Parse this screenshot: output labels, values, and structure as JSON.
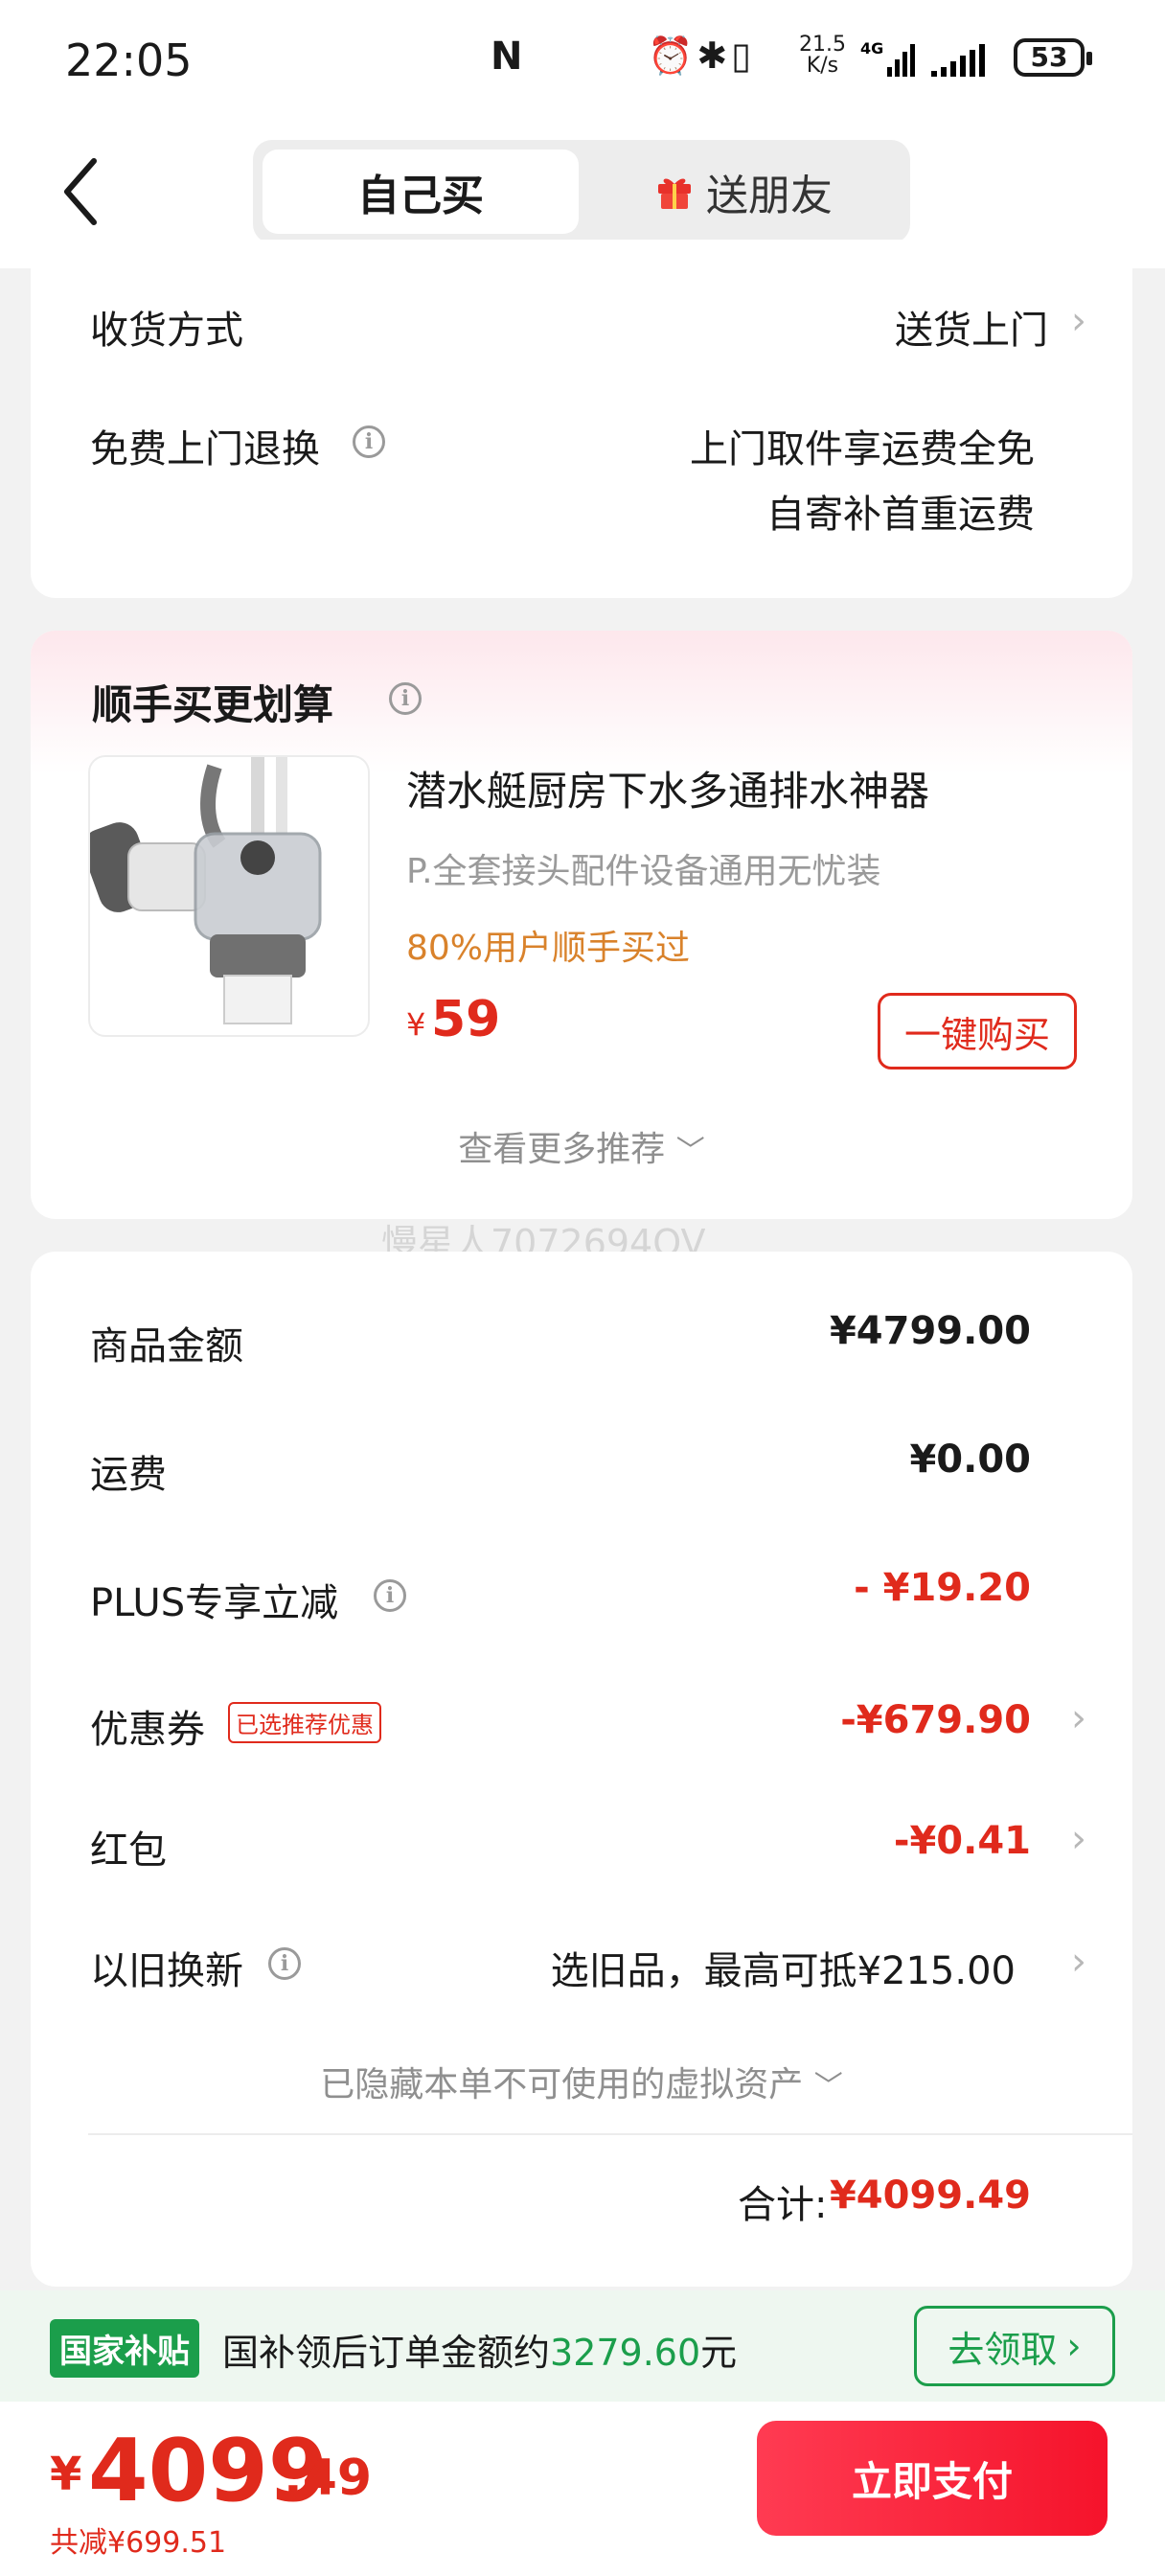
{
  "status": {
    "time": "22:05",
    "nfc": "N",
    "speed_value": "21.5",
    "speed_unit": "K/s",
    "battery": "53"
  },
  "tabs": {
    "self": "自己买",
    "gift": "送朋友"
  },
  "delivery": {
    "method_label": "收货方式",
    "method_value": "送货上门",
    "return_label": "免费上门退换",
    "return_line1": "上门取件享运费全免",
    "return_line2": "自寄补首重运费"
  },
  "addon": {
    "title": "顺手买更划算",
    "product_name": "潜水艇厨房下水多通排水神器",
    "product_desc": "P.全套接头配件设备通用无忧装",
    "product_tag": "80%用户顺手买过",
    "currency": "¥",
    "price": "59",
    "buy_button": "一键购买",
    "more": "查看更多推荐"
  },
  "watermark": "慢星人7072694OV",
  "summary": {
    "rows": [
      {
        "label": "商品金额",
        "value": "¥4799.00"
      },
      {
        "label": "运费",
        "value": "¥0.00"
      },
      {
        "label": "PLUS专享立减",
        "value": "- ¥19.20"
      },
      {
        "label": "优惠券",
        "badge": "已选推荐优惠",
        "value": "-¥679.90"
      },
      {
        "label": "红包",
        "value": "-¥0.41"
      },
      {
        "label": "以旧换新",
        "value": "选旧品，最高可抵¥215.00"
      }
    ],
    "hidden_note": "已隐藏本单不可使用的虚拟资产",
    "total_label": "合计:",
    "total_value": "¥4099.49"
  },
  "subsidy": {
    "badge": "国家补贴",
    "text_prefix": "国补领后订单金额约",
    "amount": "3279.60",
    "text_suffix": "元",
    "button": "去领取"
  },
  "footer": {
    "currency": "¥",
    "price_int": "4099",
    "price_dec": ".49",
    "saved": "共减¥699.51",
    "pay_button": "立即支付"
  },
  "colors": {
    "accent": "#e02a1c",
    "pay_gradient": [
      "#ff3b52",
      "#f5132b"
    ],
    "green": "#1b9e4b",
    "orange": "#d9822b"
  }
}
